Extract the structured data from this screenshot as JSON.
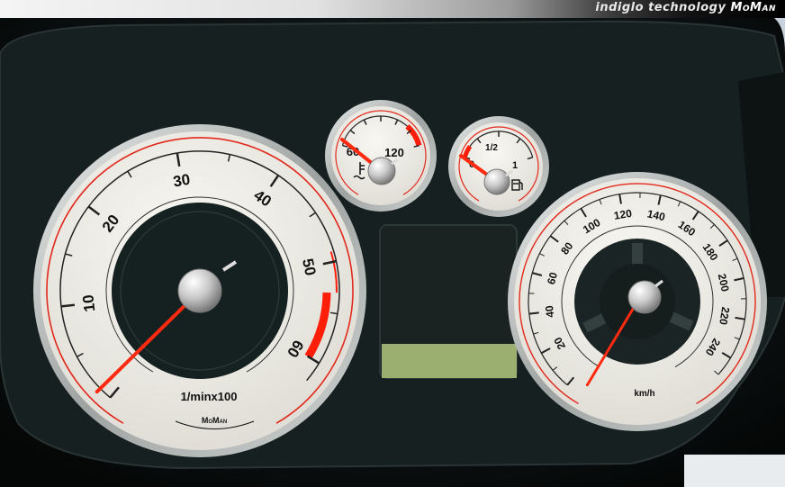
{
  "header": {
    "tagline": "indiglo technology",
    "brand": "MoMan"
  },
  "tachometer": {
    "ticks": [
      "10",
      "20",
      "30",
      "40",
      "50",
      "60"
    ],
    "unit": "1/minx100",
    "brand": "MoMan",
    "reading": 5.5
  },
  "speedometer": {
    "ticks": [
      "20",
      "40",
      "60",
      "80",
      "100",
      "120",
      "140",
      "160",
      "180",
      "200",
      "220",
      "240"
    ],
    "unit": "km/h",
    "reading": 0
  },
  "temperature_gauge": {
    "ticks": [
      "60",
      "120"
    ],
    "icon": "coolant-temperature-icon",
    "reading": 60
  },
  "fuel_gauge": {
    "ticks": [
      "0",
      "1/2",
      "1"
    ],
    "icon": "fuel-pump-icon",
    "reading": 0.1
  },
  "colors": {
    "dial_face": "#ecebe6",
    "needle": "#ff2a10",
    "redline": "#ff1e0a",
    "lcd": "#9bb070"
  }
}
